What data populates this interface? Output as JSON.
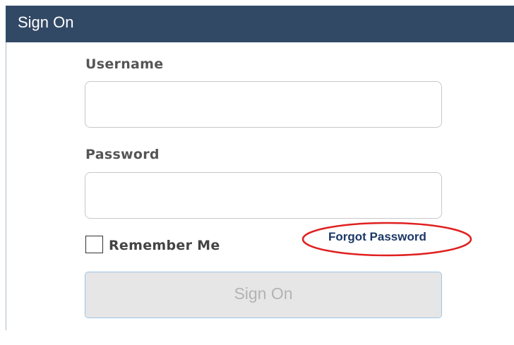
{
  "header": {
    "title": "Sign On"
  },
  "form": {
    "username_label": "Username",
    "username_value": "",
    "password_label": "Password",
    "password_value": "",
    "remember_label": "Remember Me",
    "remember_checked": false,
    "forgot_label": "Forgot Password",
    "submit_label": "Sign On"
  },
  "colors": {
    "header_bg": "#324966",
    "link": "#1c3966",
    "annotation": "#e02020",
    "button_bg": "#e6e6e6",
    "button_border": "#9ec5e6"
  }
}
